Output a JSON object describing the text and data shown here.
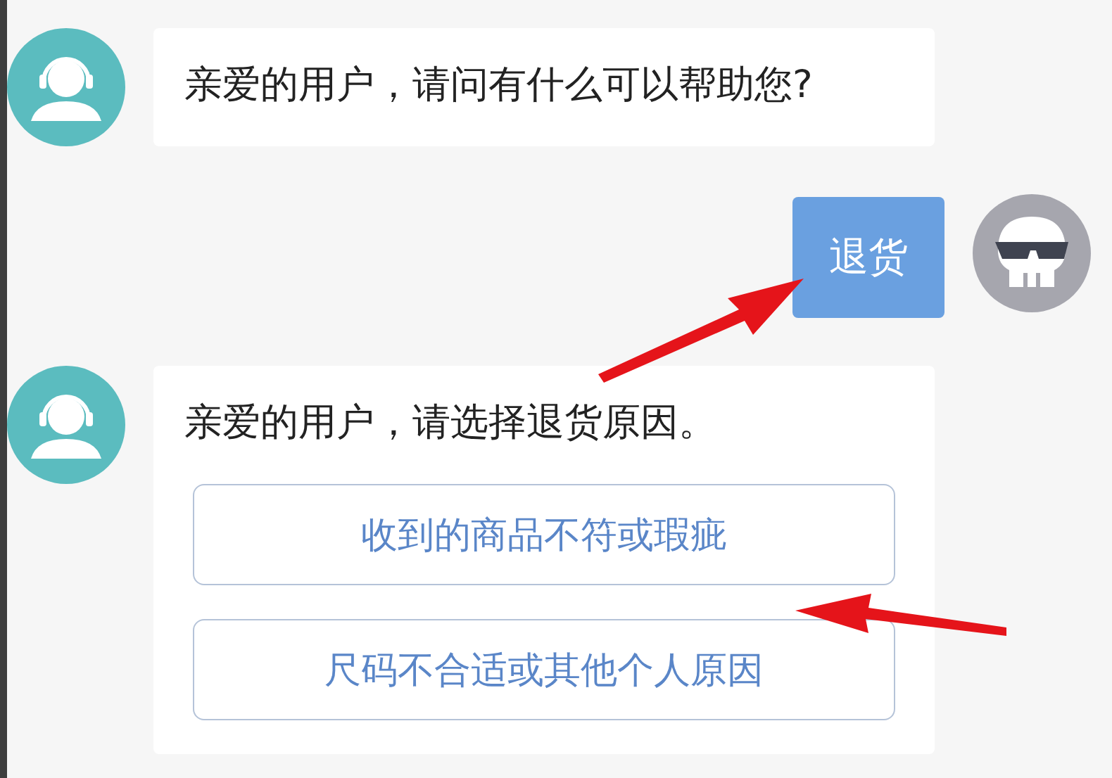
{
  "messages": [
    {
      "kind": "bot",
      "text": "亲爱的用户，请问有什么可以帮助您?"
    },
    {
      "kind": "user",
      "text": "退货"
    },
    {
      "kind": "bot",
      "text": "亲爱的用户，请选择退货原因。",
      "options": [
        "收到的商品不符或瑕疵",
        "尺码不合适或其他个人原因"
      ]
    }
  ]
}
